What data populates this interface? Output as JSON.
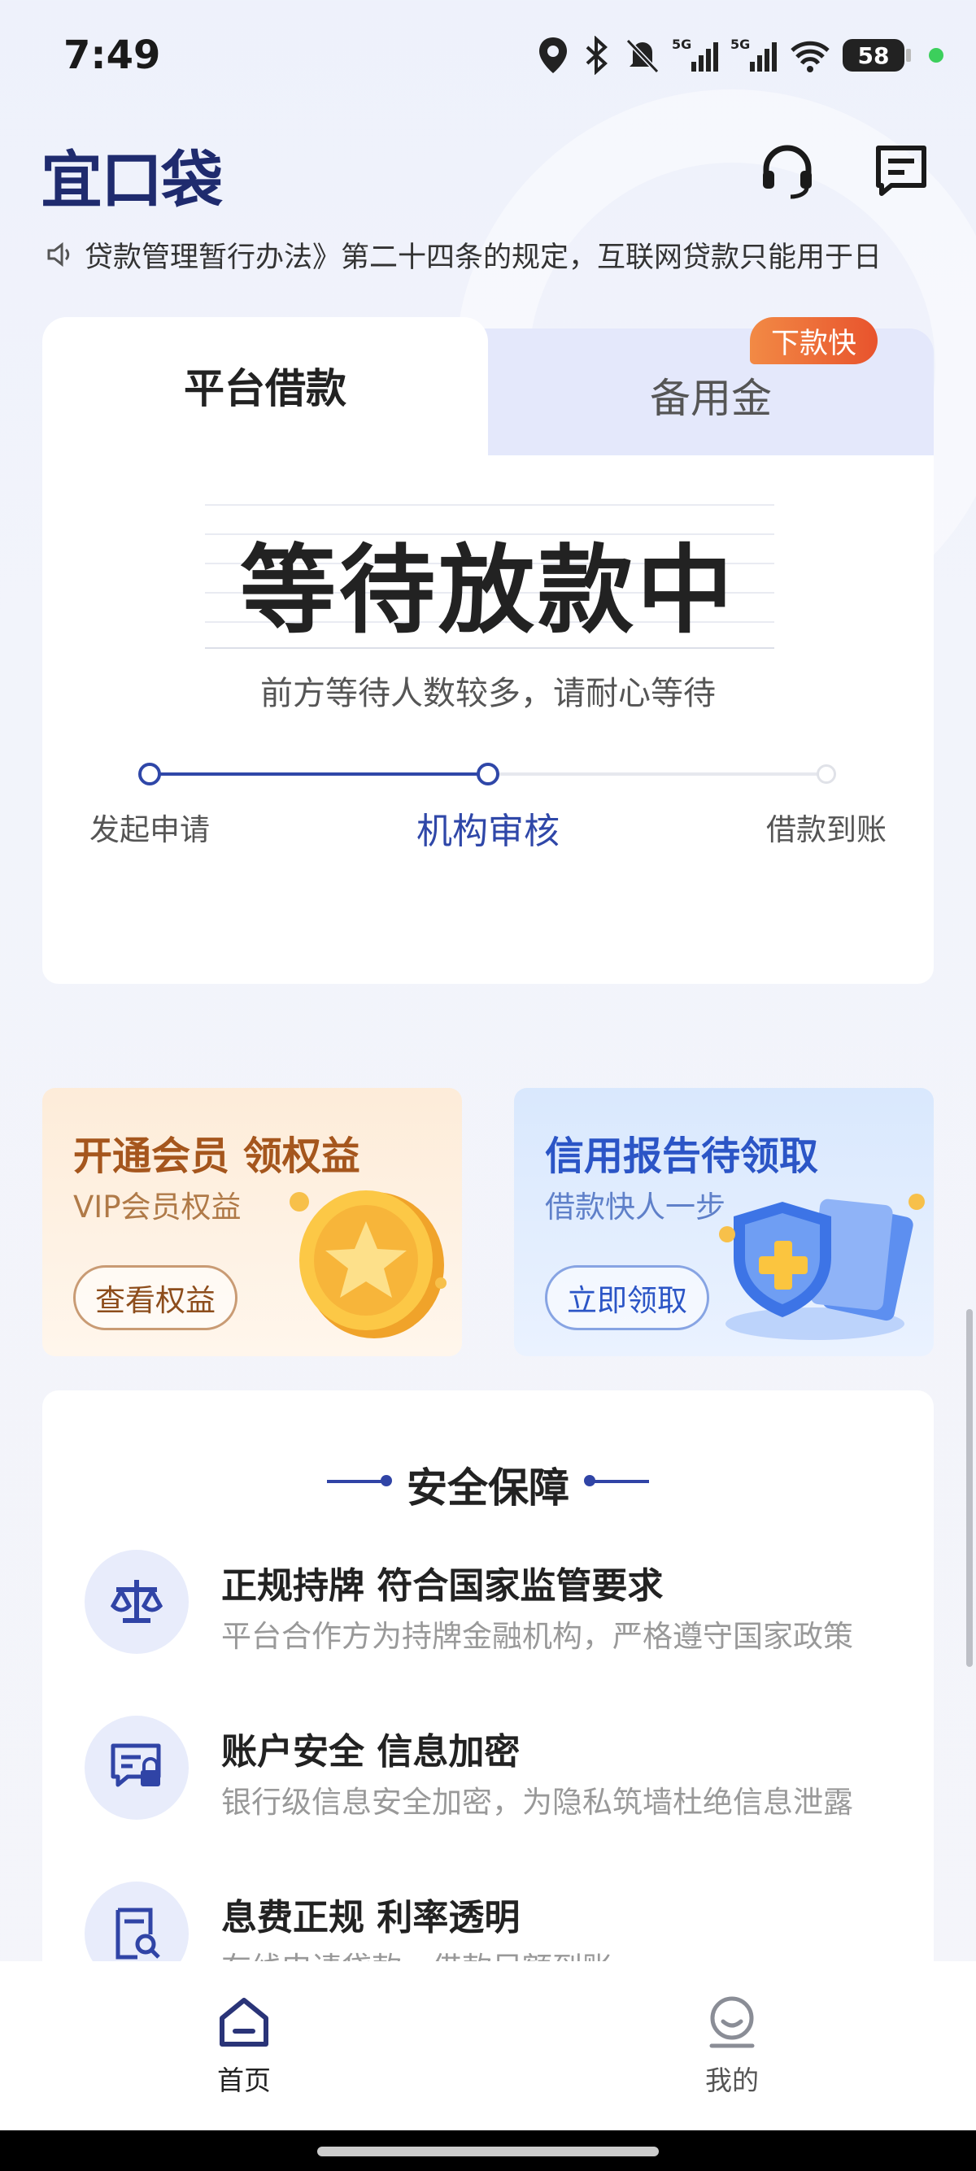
{
  "status_bar": {
    "time": "7:49",
    "battery": "58"
  },
  "header": {
    "logo": "宜口袋"
  },
  "notice": {
    "text": "贷款管理暂行办法》第二十四条的规定，互联网贷款只能用于日"
  },
  "loan_card": {
    "tab_active": "平台借款",
    "tab_inactive": "备用金",
    "tab_badge": "下款快",
    "status_title": "等待放款中",
    "status_sub": "前方等待人数较多，请耐心等待",
    "steps": [
      "发起申请",
      "机构审核",
      "借款到账"
    ],
    "current_step_index": 1
  },
  "promos": {
    "vip": {
      "title": "开通会员 领权益",
      "subtitle": "VIP会员权益",
      "button": "查看权益"
    },
    "credit": {
      "title": "信用报告待领取",
      "subtitle": "借款快人一步",
      "button": "立即领取"
    }
  },
  "security": {
    "title": "安全保障",
    "items": [
      {
        "title": "正规持牌 符合国家监管要求",
        "desc": "平台合作方为持牌金融机构，严格遵守国家政策",
        "icon": "scale-icon"
      },
      {
        "title": "账户安全 信息加密",
        "desc": "银行级信息安全加密，为隐私筑墙杜绝信息泄露",
        "icon": "lock-message-icon"
      },
      {
        "title": "息费正规  利率透明",
        "desc": "在线申请贷款，借款足额到账",
        "icon": "document-search-icon"
      }
    ]
  },
  "bottom_nav": {
    "home": "首页",
    "me": "我的"
  },
  "colors": {
    "brand": "#1f2b6e",
    "accent": "#2f47a8",
    "badge": "#e8532d"
  }
}
